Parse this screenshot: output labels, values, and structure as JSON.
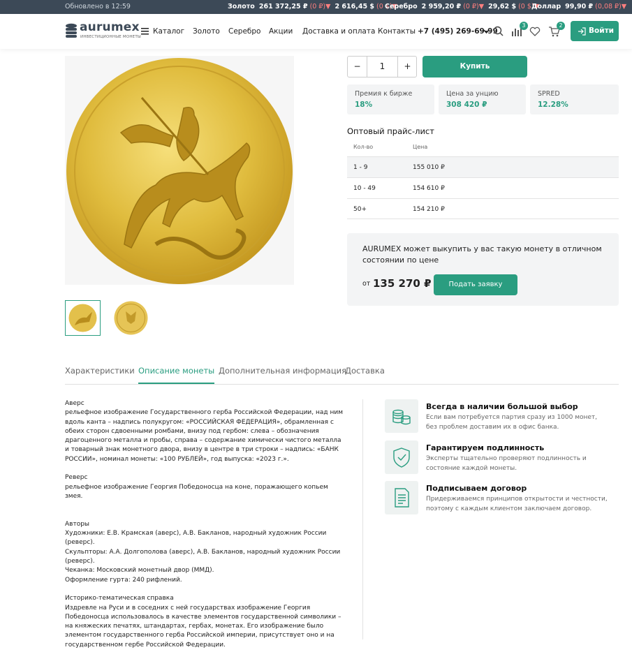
{
  "topbar": {
    "updated": "Обновлено в 12:59",
    "gold_label": "Золото",
    "gold_rub": "261 372,25 ₽",
    "gold_rub_change": "(0 ₽)",
    "gold_usd": "2 616,45 $",
    "gold_usd_change": "(0 $)",
    "silver_label": "Серебро",
    "silver_rub": "2 959,20 ₽",
    "silver_rub_change": "(0 ₽)",
    "silver_usd": "29,62 $",
    "silver_usd_change": "(0 $)",
    "dollar_label": "Доллар",
    "dollar_rub": "99,90 ₽",
    "dollar_rub_change": "(0,08 ₽)",
    "down_arrow": "▼"
  },
  "header": {
    "logo_name": "aurumex",
    "logo_sub": "ИНВЕСТИЦИОННЫЕ МОНЕТЫ",
    "nav": [
      "Каталог",
      "Золото",
      "Серебро",
      "Акции",
      "Доставка и оплата",
      "Контакты"
    ],
    "phone": "+7 (495) 269-69-99",
    "compare_count": "3",
    "cart_count": "2",
    "login": "Войти"
  },
  "product": {
    "quantity": "1",
    "minus": "−",
    "plus": "+",
    "buy": "Купить",
    "stats": [
      {
        "label": "Премия к бирже",
        "value": "18%"
      },
      {
        "label": "Цена за унцию",
        "value": "308 420 ₽"
      },
      {
        "label": "SPRED",
        "value": "12.28%"
      }
    ],
    "wholesale_title": "Оптовый прайс-лист",
    "wholesale_headers": [
      "Кол-во",
      "Цена"
    ],
    "wholesale_rows": [
      {
        "qty": "1 - 9",
        "price": "155 010 ₽"
      },
      {
        "qty": "10 - 49",
        "price": "154 610 ₽"
      },
      {
        "qty": "50+",
        "price": "154 210 ₽"
      }
    ],
    "buyback_text": "AURUMEX может выкупить у вас такую монету в отличном состоянии по цене",
    "buyback_from": "от",
    "buyback_price": "135 270 ₽",
    "buyback_button": "Подать заявку"
  },
  "tabs": [
    "Характеристики",
    "Описание монеты",
    "Дополнительная информация",
    "Доставка"
  ],
  "description": [
    {
      "title": "Аверс",
      "text": "рельефное изображение Государственного герба Российской Федерации, над ним вдоль канта – надпись полукругом: «РОССИЙСКАЯ ФЕДЕРАЦИЯ», обрамленная с обеих сторон сдвоенными ромбами, внизу под гербом: слева – обозначения драгоценного металла и пробы, справа – содержание химически чистого металла и товарный знак монетного двора, внизу в центре в три строки – надпись: «БАНК РОССИИ», номинал монеты: «100 РУБЛЕЙ», год выпуска: «2023 г.»."
    },
    {
      "title": "Реверс",
      "text": "рельефное изображение Георгия Победоносца на коне, поражающего копьем змея."
    },
    {
      "title": "Авторы",
      "text": "Художники: Е.В. Крамская (аверс), А.В. Бакланов, народный художник России (реверс).\nСкульпторы: А.А. Долгополова (аверс), А.В. Бакланов, народный художник России (реверс).\nЧеканка: Московский монетный двор (ММД).\nОформление гурта: 240 рифлений."
    },
    {
      "title": "Историко-тематическая справка",
      "text": "Издревле на Руси и в соседних с ней государствах изображение Георгия Победоносца использовалось в качестве элементов государственной символики – на княжеских печатях, штандартах, гербах, монетах. Его изображение было элементом государственного герба Российской империи, присутствует оно и на государственном гербе Российской Федерации."
    }
  ],
  "features": [
    {
      "title": "Всегда в наличии большой выбор",
      "text": "Если вам потребуется партия сразу из 1000 монет, без проблем доставим их в офис банка.",
      "icon": "coins-icon"
    },
    {
      "title": "Гарантируем подлинность",
      "text": "Эксперты тщательно проверяют подлинность и состояние каждой монеты.",
      "icon": "shield-check-icon"
    },
    {
      "title": "Подписываем договор",
      "text": "Придерживаемся принципов открытости и честности, поэтому с каждым клиентом заключаем договор.",
      "icon": "document-icon"
    }
  ],
  "colors": {
    "accent": "#2a9d80",
    "topbar": "#3c4957",
    "negative": "#ff7f7f"
  }
}
